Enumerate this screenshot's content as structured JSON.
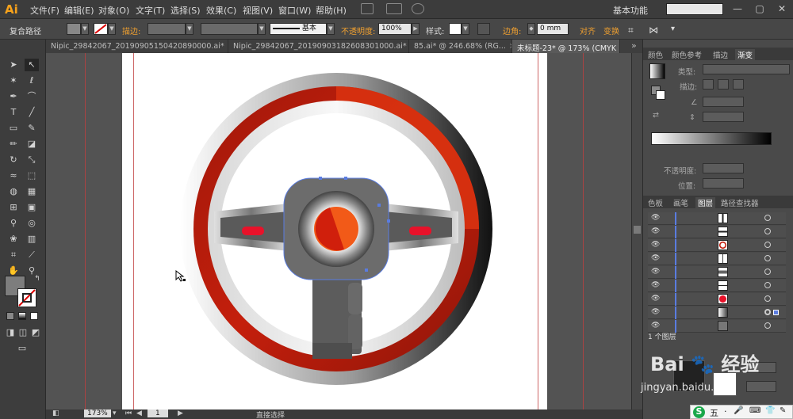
{
  "app": {
    "logo": "Ai",
    "menu": [
      "文件(F)",
      "编辑(E)",
      "对象(O)",
      "文字(T)",
      "选择(S)",
      "效果(C)",
      "视图(V)",
      "窗口(W)",
      "帮助(H)"
    ],
    "workspace": "基本功能",
    "window_buttons": [
      "—",
      "▢",
      "✕"
    ]
  },
  "control_bar": {
    "selection_type": "复合路径",
    "stroke_label": "描边:",
    "stroke_style": "基本",
    "opacity_label": "不透明度:",
    "opacity_value": "100%",
    "style_label": "样式:",
    "corner_label": "边角:",
    "corner_value": "0 mm",
    "align_label": "对齐",
    "transform_label": "变换"
  },
  "tabs": [
    {
      "label": "Nipic_29842067_20190905150420890000.ai*",
      "close": "×",
      "active": false
    },
    {
      "label": "Nipic_29842067_20190903182608301000.ai*",
      "close": "×",
      "active": false
    },
    {
      "label": "85.ai* @ 246.68% (RG...",
      "close": "×",
      "active": false
    },
    {
      "label": "未标题-23* @ 173% (CMYK",
      "close": "×",
      "active": true
    }
  ],
  "status_bar": {
    "zoom": "173%",
    "page": "1",
    "tool_name": "直接选择"
  },
  "panels": {
    "gradient_tabs": [
      "颜色",
      "颜色参考",
      "描边",
      "渐变"
    ],
    "gradient_type_label": "类型:",
    "gradient_stroke_label": "描边:",
    "opacity_label": "不透明度:",
    "position_label": "位置:",
    "layer_tabs": [
      "色板",
      "画笔",
      "图层",
      "路径查找器"
    ],
    "layers_count": "1 个图层"
  },
  "colors": {
    "ring_red": "#c21a0a",
    "highlight_red": "#d6310e",
    "center_orange": "#f25a18",
    "grip_red": "#e8122a",
    "hub_gray": "#6c6c6c",
    "accent_blue": "#5a7ce0"
  },
  "watermark": {
    "brand": "Bai",
    "text": "经验",
    "url": "jingyan.baidu.com"
  },
  "ime": {
    "labels": [
      "S",
      "五",
      "·",
      "🎤",
      "⌨",
      "👕",
      "✎"
    ]
  }
}
